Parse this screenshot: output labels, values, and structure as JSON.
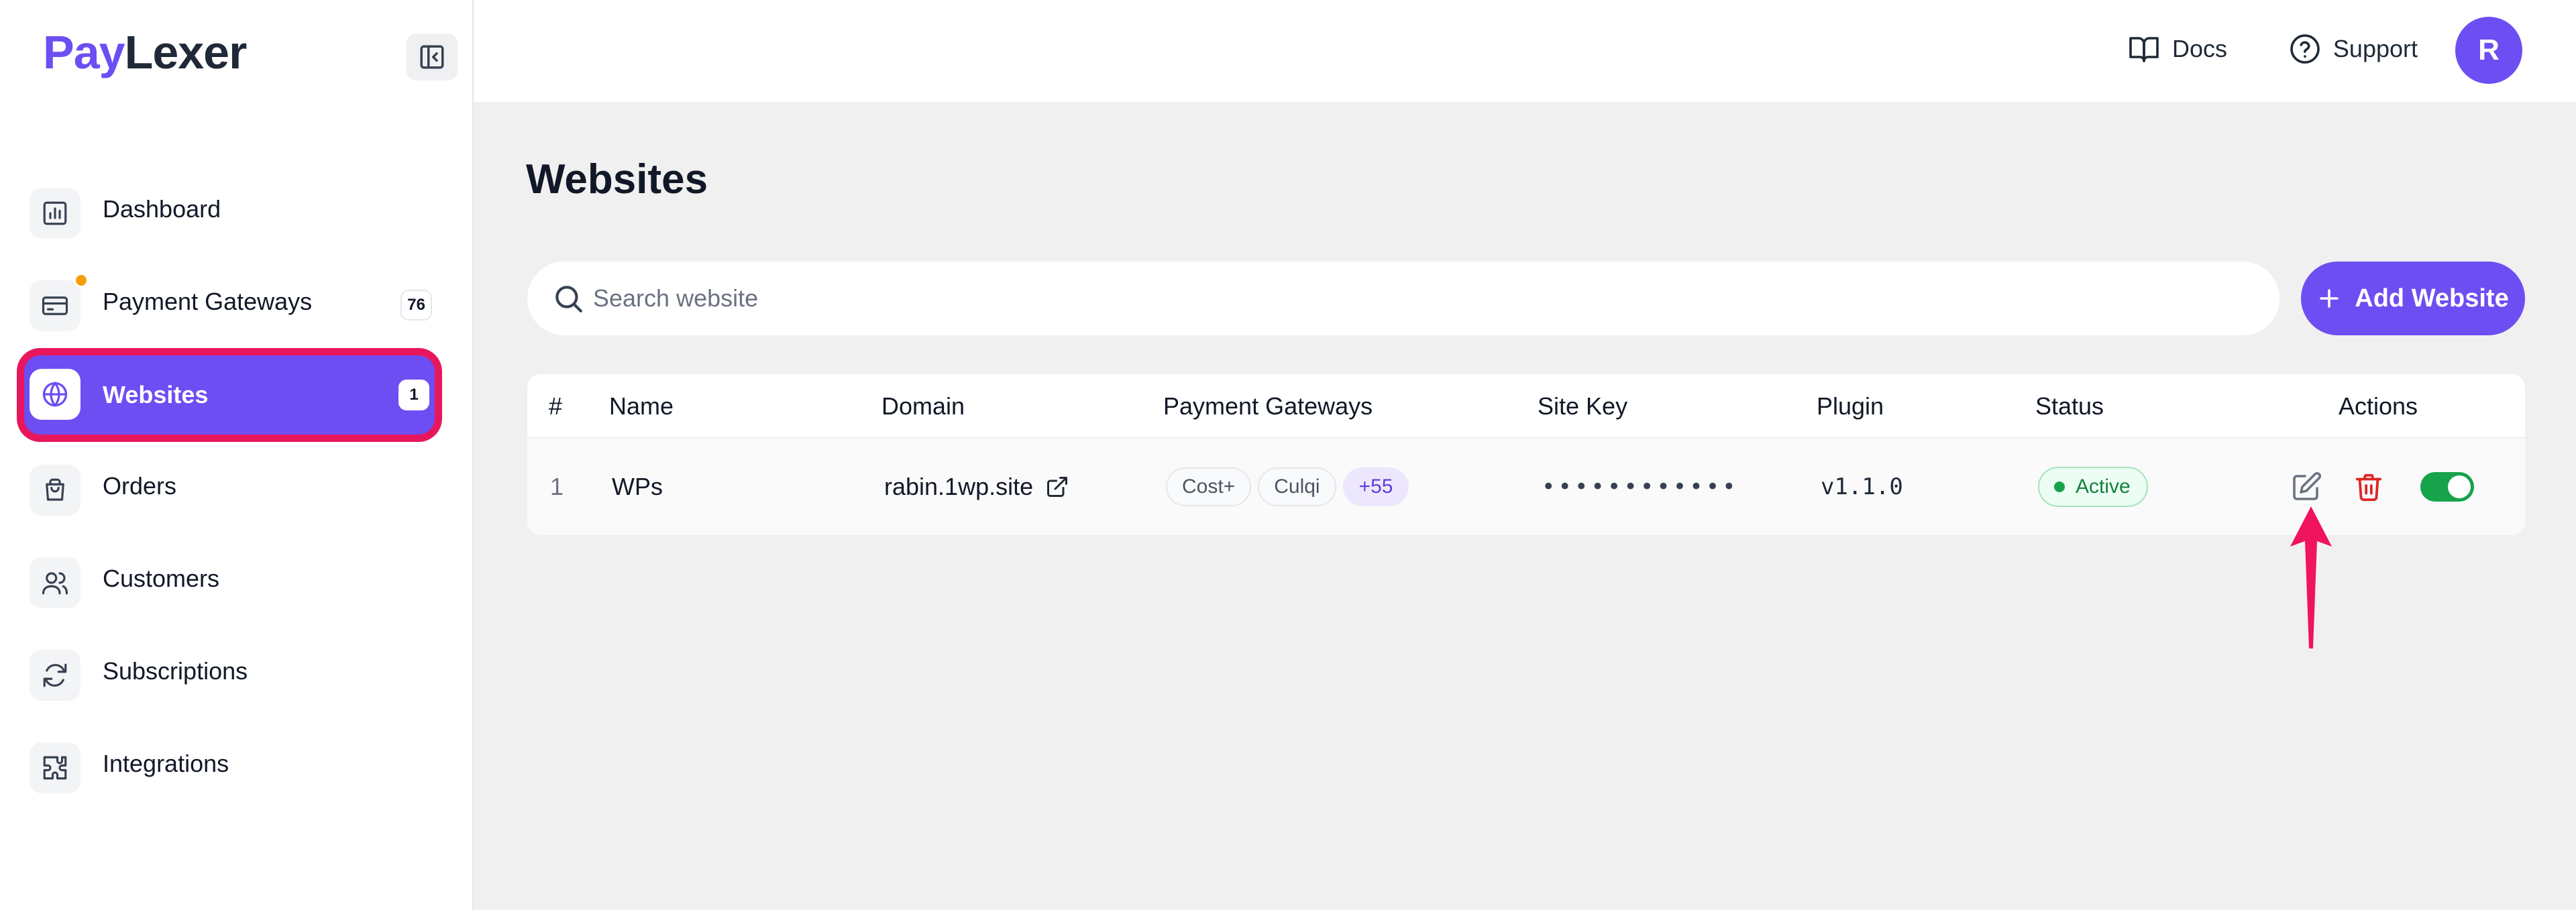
{
  "brand": {
    "part1": "Pay",
    "part2": "Lexer"
  },
  "sidebar": {
    "items": [
      {
        "label": "Dashboard",
        "icon": "bar-chart-icon",
        "badge": null
      },
      {
        "label": "Payment Gateways",
        "icon": "credit-card-icon",
        "badge": "76",
        "dot": true
      },
      {
        "label": "Websites",
        "icon": "globe-icon",
        "badge": "1",
        "active": true
      },
      {
        "label": "Orders",
        "icon": "shopping-bag-icon",
        "badge": null
      },
      {
        "label": "Customers",
        "icon": "users-icon",
        "badge": null
      },
      {
        "label": "Subscriptions",
        "icon": "refresh-icon",
        "badge": null
      },
      {
        "label": "Integrations",
        "icon": "puzzle-icon",
        "badge": null
      }
    ]
  },
  "topbar": {
    "docs_label": "Docs",
    "support_label": "Support",
    "avatar_initial": "R"
  },
  "main": {
    "title": "Websites",
    "search": {
      "placeholder": "Search website",
      "value": ""
    },
    "add_button_label": "Add Website",
    "table": {
      "headers": [
        "#",
        "Name",
        "Domain",
        "Payment Gateways",
        "Site Key",
        "Plugin",
        "Status",
        "Actions"
      ],
      "rows": [
        {
          "index": "1",
          "name": "WPs",
          "domain": "rabin.1wp.site",
          "gateways": [
            "Cost+",
            "Culqi"
          ],
          "gateways_more": "+55",
          "site_key": "••••••••••••",
          "plugin": "v1.1.0",
          "status": "Active",
          "enabled": true
        }
      ]
    }
  },
  "colors": {
    "accent": "#6d4ef2",
    "highlight": "#e8175d",
    "success": "#16a34a",
    "danger": "#dc2626",
    "notification": "#f59e0b"
  }
}
